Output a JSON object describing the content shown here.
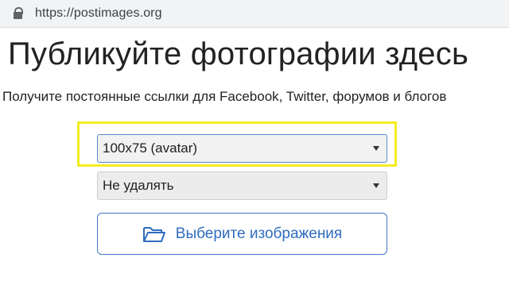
{
  "browser": {
    "url": "https://postimages.org"
  },
  "page": {
    "headline": "Публикуйте фотографии здесь",
    "subheadline": "Получите постоянные ссылки для Facebook, Twitter, форумов и блогов"
  },
  "form": {
    "size_select_value": "100x75 (avatar)",
    "expire_select_value": "Не удалять",
    "choose_button_label": "Выберите изображения"
  },
  "icons": {
    "lock": "lock-icon",
    "folder": "folder-open-icon",
    "dropdown": "chevron-down-icon"
  },
  "colors": {
    "highlight": "#f5ec1f",
    "accent": "#2f6cc0"
  }
}
